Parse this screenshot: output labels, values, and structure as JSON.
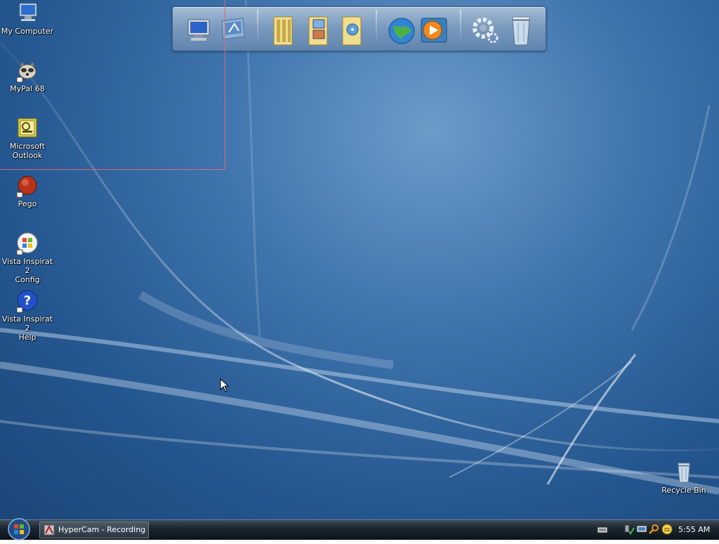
{
  "desktop": {
    "icons": [
      {
        "label": "My Computer",
        "icon": "computer-icon"
      },
      {
        "label": "MyPal 68",
        "icon": "raccoon-icon"
      },
      {
        "label": "Microsoft\nOutlook",
        "icon": "outlook-icon"
      },
      {
        "label": "Pego",
        "icon": "pego-icon"
      },
      {
        "label": "Vista Inspirat 2\nConfig",
        "icon": "windows-logo-icon"
      },
      {
        "label": "Vista Inspirat 2\nHelp",
        "icon": "help-icon"
      },
      {
        "label": "Recycle Bin",
        "icon": "recycle-bin-icon"
      }
    ]
  },
  "dock": {
    "items": [
      "computer-icon",
      "desktop-icon",
      "documents-folder-icon",
      "pictures-folder-icon",
      "music-folder-icon",
      "internet-globe-icon",
      "media-player-icon",
      "settings-gear-icon",
      "recycle-bin-icon"
    ]
  },
  "taskbar": {
    "start_icon": "windows-orb-icon",
    "task_label": "HyperCam - Recording",
    "tray_icons": [
      "keyboard-icon",
      "network-icon",
      "monitor-icon",
      "search-icon",
      "smiley-icon"
    ],
    "clock": "5:55 AM"
  },
  "colors": {
    "taskbar": "#1d2731",
    "desktop_accent": "#3f74ad",
    "selection_border": "#d66a7a"
  }
}
